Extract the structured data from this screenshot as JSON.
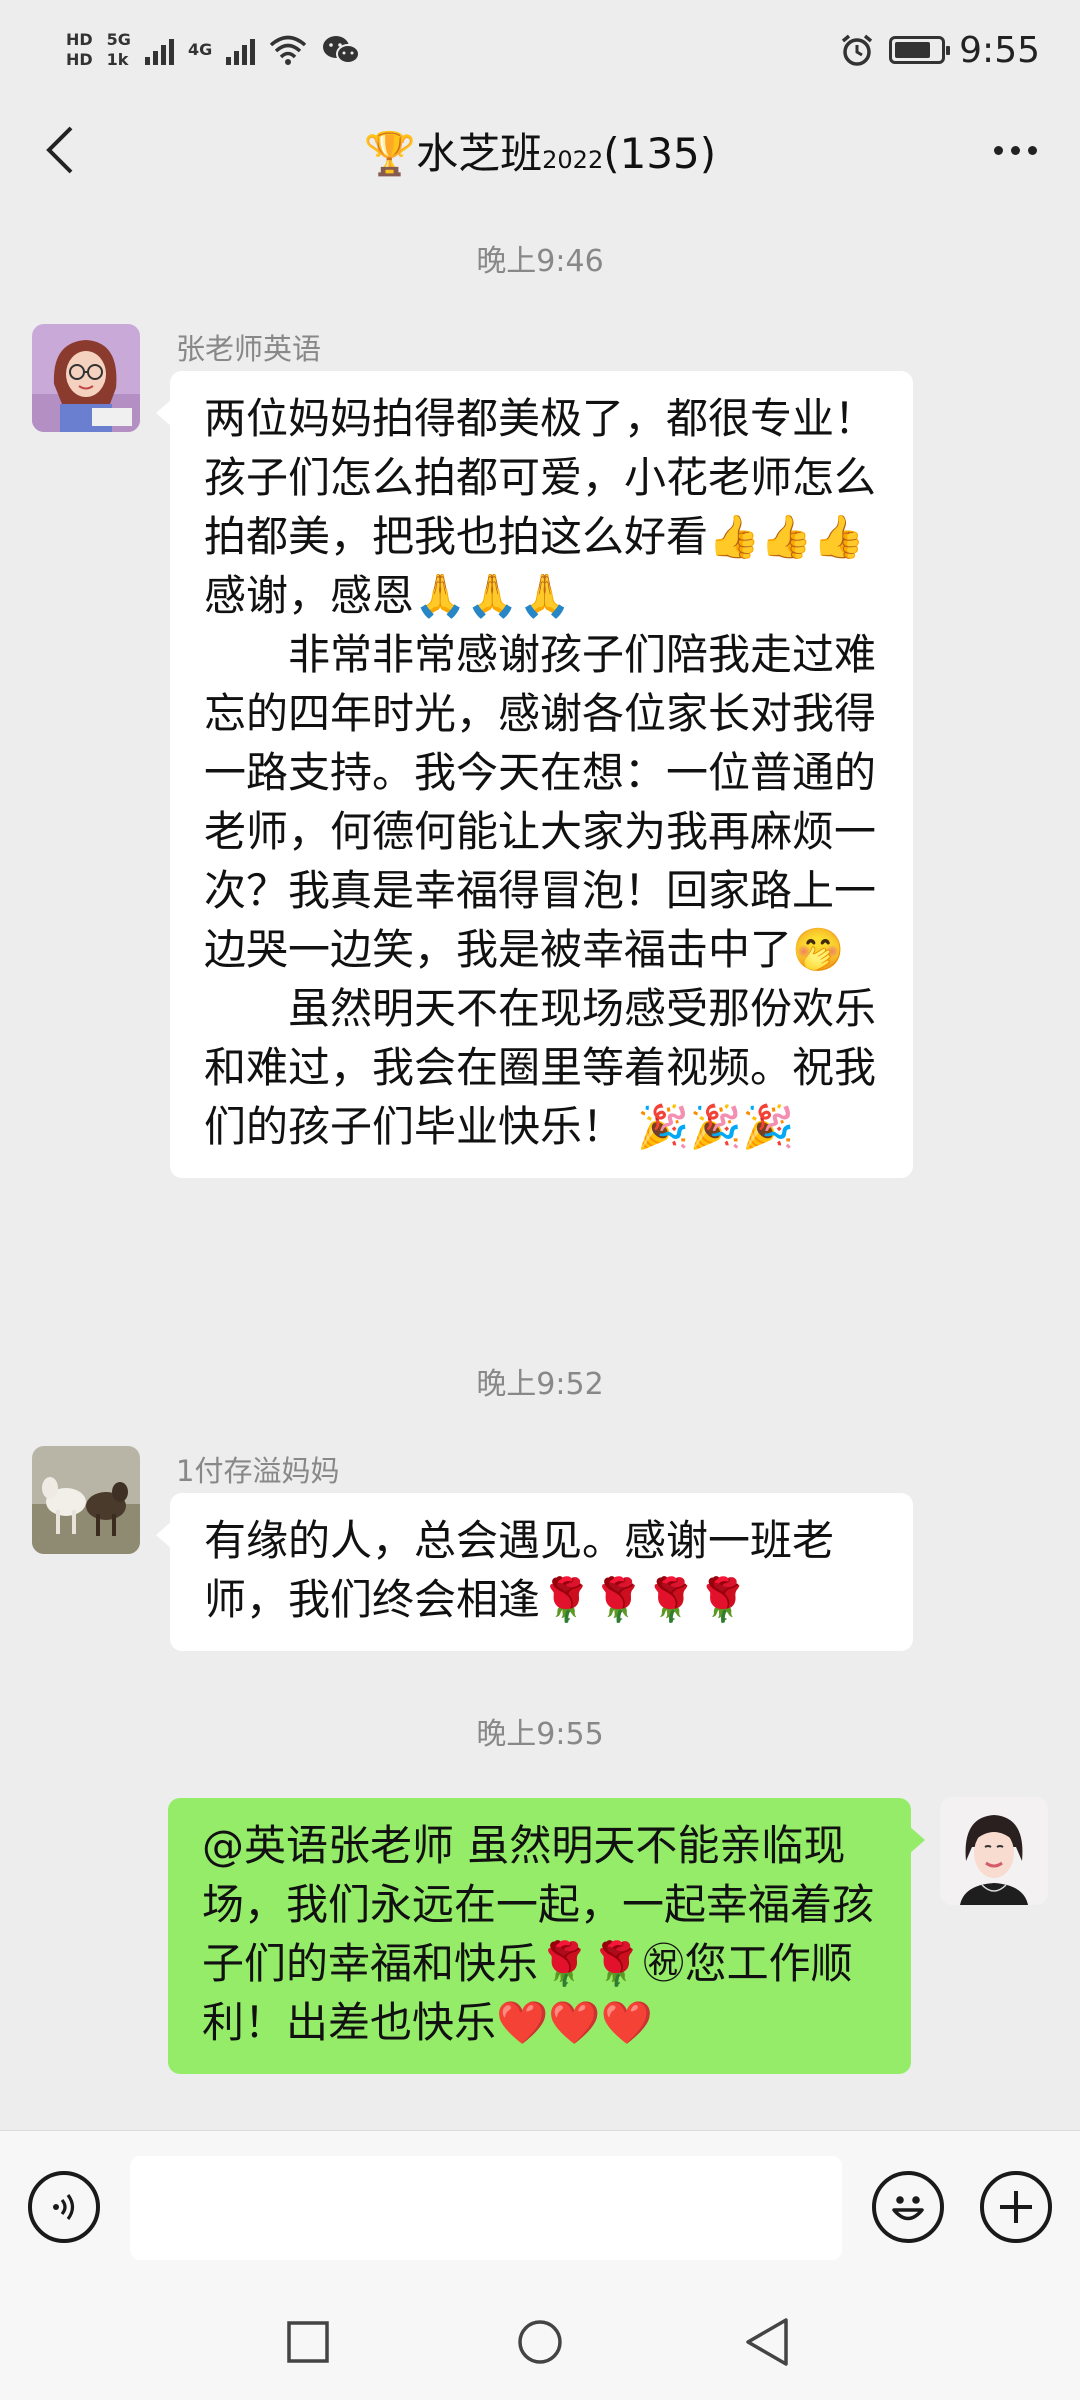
{
  "status_bar": {
    "hd_top": "HD",
    "hd_bottom": "HD",
    "net_5g": "5G",
    "net_1k": "1k",
    "net_4g": "4G",
    "time": "9:55",
    "icons": [
      "signal-icon",
      "wifi-icon",
      "wechat-icon",
      "alarm-icon",
      "battery-icon"
    ]
  },
  "header": {
    "trophy": "🏆",
    "title_main": "水芝班",
    "title_sup": "2022",
    "title_count": "(135)"
  },
  "messages": {
    "ts1": "晚上9:46",
    "m1_sender": "张老师英语",
    "m1_text": "两位妈妈拍得都美极了，都很专业！孩子们怎么拍都可爱，小花老师怎么拍都美，把我也拍这么好看👍👍👍感谢，感恩🙏🙏🙏\n　　非常非常感谢孩子们陪我走过难忘的四年时光，感谢各位家长对我得一路支持。我今天在想：一位普通的老师，何德何能让大家为我再麻烦一次？我真是幸福得冒泡！回家路上一边哭一边笑，我是被幸福击中了🤭\n　　虽然明天不在现场感受那份欢乐和难过，我会在圈里等着视频。祝我们的孩子们毕业快乐！ 🎉🎉🎉",
    "ts2": "晚上9:52",
    "m2_sender": "1付存溢妈妈",
    "m2_text": "有缘的人，总会遇见。感谢一班老师，我们终会相逢🌹🌹🌹🌹",
    "ts3": "晚上9:55",
    "m3_text": "@英语张老师 虽然明天不能亲临现场，我们永远在一起，一起幸福着孩子们的幸福和快乐🌹🌹㊗您工作顺利！出差也快乐❤️❤️❤️"
  },
  "input_bar": {
    "placeholder": "",
    "icons": [
      "voice-icon",
      "emoji-icon",
      "plus-icon"
    ]
  },
  "colors": {
    "background": "#ededed",
    "bubble_in": "#ffffff",
    "bubble_out": "#95ec69"
  }
}
